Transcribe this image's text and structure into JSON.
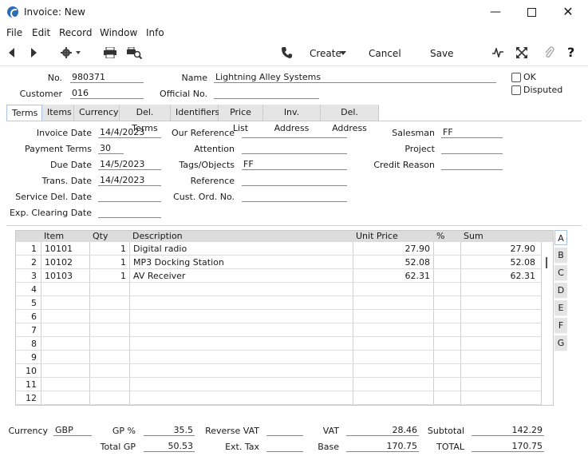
{
  "window": {
    "title": "Invoice: New"
  },
  "menu": [
    "File",
    "Edit",
    "Record",
    "Window",
    "Info"
  ],
  "toolbar": {
    "create": "Create",
    "cancel": "Cancel",
    "save": "Save"
  },
  "header": {
    "no_label": "No.",
    "no_value": "980371",
    "customer_label": "Customer",
    "customer_value": "016",
    "name_label": "Name",
    "name_value": "Lightning Alley Systems",
    "official_label": "Official No.",
    "official_value": "",
    "ok_label": "OK",
    "disputed_label": "Disputed"
  },
  "tabs": [
    "Terms",
    "Items",
    "Currency",
    "Del. Terms",
    "Identifiers",
    "Price List",
    "Inv. Address",
    "Del. Address"
  ],
  "terms": {
    "invoice_date_label": "Invoice Date",
    "invoice_date": "14/4/2023",
    "payment_terms_label": "Payment Terms",
    "payment_terms": "30",
    "due_date_label": "Due Date",
    "due_date": "14/5/2023",
    "trans_date_label": "Trans. Date",
    "trans_date": "14/4/2023",
    "service_del_label": "Service Del. Date",
    "service_del": "",
    "exp_clearing_label": "Exp. Clearing Date",
    "exp_clearing": "",
    "our_ref_label": "Our Reference",
    "our_ref": "",
    "attention_label": "Attention",
    "attention": "",
    "tags_label": "Tags/Objects",
    "tags": "FF",
    "reference_label": "Reference",
    "reference": "",
    "cust_ord_label": "Cust. Ord. No.",
    "cust_ord": "",
    "salesman_label": "Salesman",
    "salesman": "FF",
    "project_label": "Project",
    "project": "",
    "credit_reason_label": "Credit Reason",
    "credit_reason": ""
  },
  "grid": {
    "headers": {
      "item": "Item",
      "qty": "Qty",
      "description": "Description",
      "unit_price": "Unit Price",
      "pct": "%",
      "sum": "Sum"
    },
    "rows": [
      {
        "n": "1",
        "item": "10101",
        "qty": "1",
        "description": "Digital radio",
        "unit_price": "27.90",
        "pct": "",
        "sum": "27.90"
      },
      {
        "n": "2",
        "item": "10102",
        "qty": "1",
        "description": "MP3 Docking Station",
        "unit_price": "52.08",
        "pct": "",
        "sum": "52.08"
      },
      {
        "n": "3",
        "item": "10103",
        "qty": "1",
        "description": "AV Receiver",
        "unit_price": "62.31",
        "pct": "",
        "sum": "62.31"
      },
      {
        "n": "4"
      },
      {
        "n": "5"
      },
      {
        "n": "6"
      },
      {
        "n": "7"
      },
      {
        "n": "8"
      },
      {
        "n": "9"
      },
      {
        "n": "10"
      },
      {
        "n": "11"
      },
      {
        "n": "12"
      }
    ],
    "side_tabs": [
      "A",
      "B",
      "C",
      "D",
      "E",
      "F",
      "G"
    ]
  },
  "footer": {
    "currency_label": "Currency",
    "currency": "GBP",
    "gp_pct_label": "GP %",
    "gp_pct": "35.5",
    "total_gp_label": "Total GP",
    "total_gp": "50.53",
    "reverse_vat_label": "Reverse VAT",
    "reverse_vat": "",
    "ext_tax_label": "Ext. Tax",
    "ext_tax": "",
    "vat_label": "VAT",
    "vat": "28.46",
    "base_label": "Base",
    "base": "170.75",
    "subtotal_label": "Subtotal",
    "subtotal": "142.29",
    "total_label": "TOTAL",
    "total": "170.75"
  }
}
